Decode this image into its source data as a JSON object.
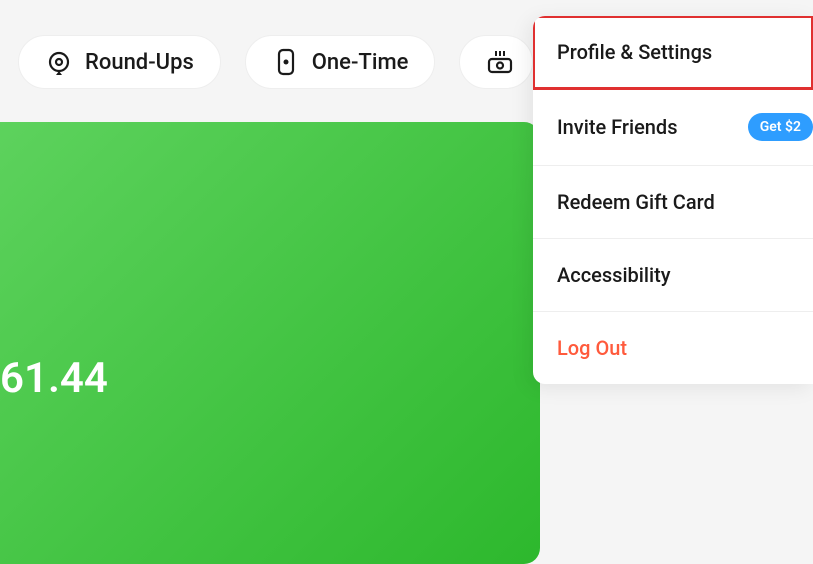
{
  "topbar": {
    "round_ups_label": "Round-Ups",
    "one_time_label": "One-Time"
  },
  "balance": {
    "display_value": "61.44"
  },
  "dropdown": {
    "profile_settings_label": "Profile & Settings",
    "invite_friends_label": "Invite Friends",
    "invite_friends_badge": "Get $2",
    "redeem_gift_card_label": "Redeem Gift Card",
    "accessibility_label": "Accessibility",
    "log_out_label": "Log Out"
  }
}
